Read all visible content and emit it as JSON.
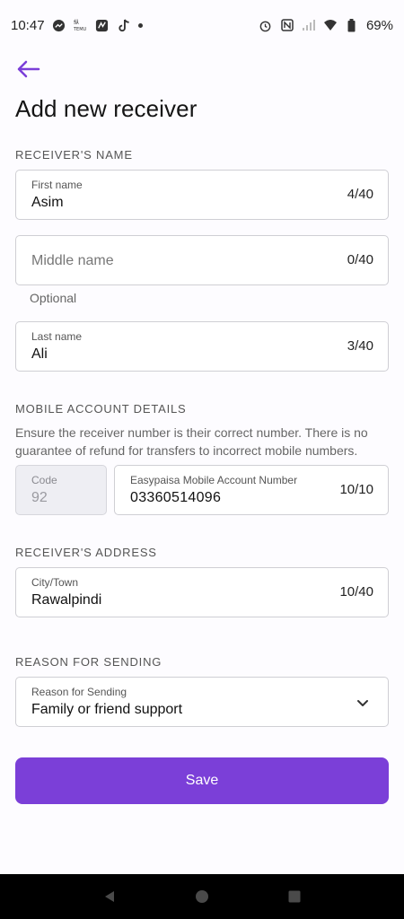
{
  "status_bar": {
    "time": "10:47",
    "battery": "69%",
    "left_icons": [
      "messenger-icon",
      "temu-icon",
      "app-icon",
      "tiktok-icon",
      "dot-icon"
    ],
    "right_icons": [
      "alarm-icon",
      "nfc-icon",
      "signal-icon",
      "wifi-icon",
      "battery-icon"
    ]
  },
  "header": {
    "title": "Add new receiver"
  },
  "receiver_name": {
    "section_label": "RECEIVER'S NAME",
    "first_name": {
      "label": "First name",
      "value": "Asim",
      "count": "4/40"
    },
    "middle_name": {
      "placeholder": "Middle name",
      "count": "0/40",
      "helper": "Optional"
    },
    "last_name": {
      "label": "Last name",
      "value": "Ali",
      "count": "3/40"
    }
  },
  "mobile": {
    "section_label": "MOBILE ACCOUNT DETAILS",
    "note": "Ensure the receiver number is their correct number. There is no guarantee of refund for transfers to incorrect mobile numbers.",
    "code": {
      "label": "Code",
      "value": "92"
    },
    "number": {
      "label": "Easypaisa Mobile Account Number",
      "value": "03360514096",
      "count": "10/10"
    }
  },
  "address": {
    "section_label": "RECEIVER'S ADDRESS",
    "city": {
      "label": "City/Town",
      "value": "Rawalpindi",
      "count": "10/40"
    }
  },
  "reason": {
    "section_label": "REASON FOR SENDING",
    "select": {
      "label": "Reason for Sending",
      "value": "Family or friend support"
    }
  },
  "actions": {
    "save_label": "Save"
  },
  "colors": {
    "accent": "#7b3fd8",
    "background": "#fdfcff"
  }
}
